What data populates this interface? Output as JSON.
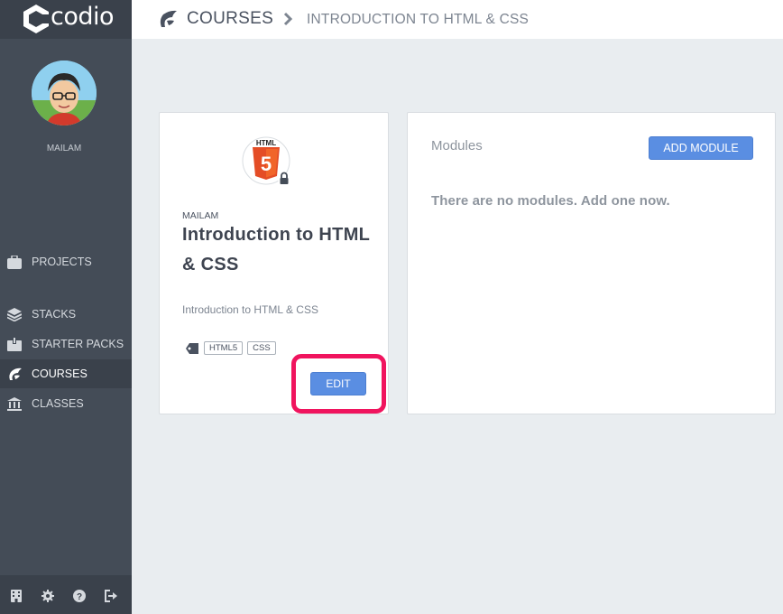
{
  "app": {
    "logo_text": "codio"
  },
  "user": {
    "name": "MAILAM"
  },
  "nav": {
    "items": [
      {
        "label": "PROJECTS",
        "icon": "briefcase-icon"
      },
      {
        "label": "STACKS",
        "icon": "layers-icon"
      },
      {
        "label": "STARTER PACKS",
        "icon": "box-icon"
      },
      {
        "label": "COURSES",
        "icon": "courses-icon",
        "active": true
      },
      {
        "label": "CLASSES",
        "icon": "bank-icon"
      }
    ]
  },
  "footer_icons": [
    "building-icon",
    "gear-icon",
    "help-icon",
    "logout-icon"
  ],
  "breadcrumb": {
    "root": "COURSES",
    "current": "INTRODUCTION TO HTML & CSS"
  },
  "course": {
    "owner": "MAILAM",
    "title": "Introduction to HTML & CSS",
    "description": "Introduction to HTML & CSS",
    "logo_text": "HTML",
    "logo_number": "5",
    "tags": [
      "HTML5",
      "CSS"
    ],
    "edit_label": "EDIT"
  },
  "modules": {
    "title": "Modules",
    "add_label": "ADD MODULE",
    "empty_message": "There are no modules. Add one now."
  },
  "colors": {
    "sidebar": "#444c57",
    "accent_button": "#5a8ee2",
    "highlight": "#f0145e",
    "html5_orange": "#e44d26"
  }
}
